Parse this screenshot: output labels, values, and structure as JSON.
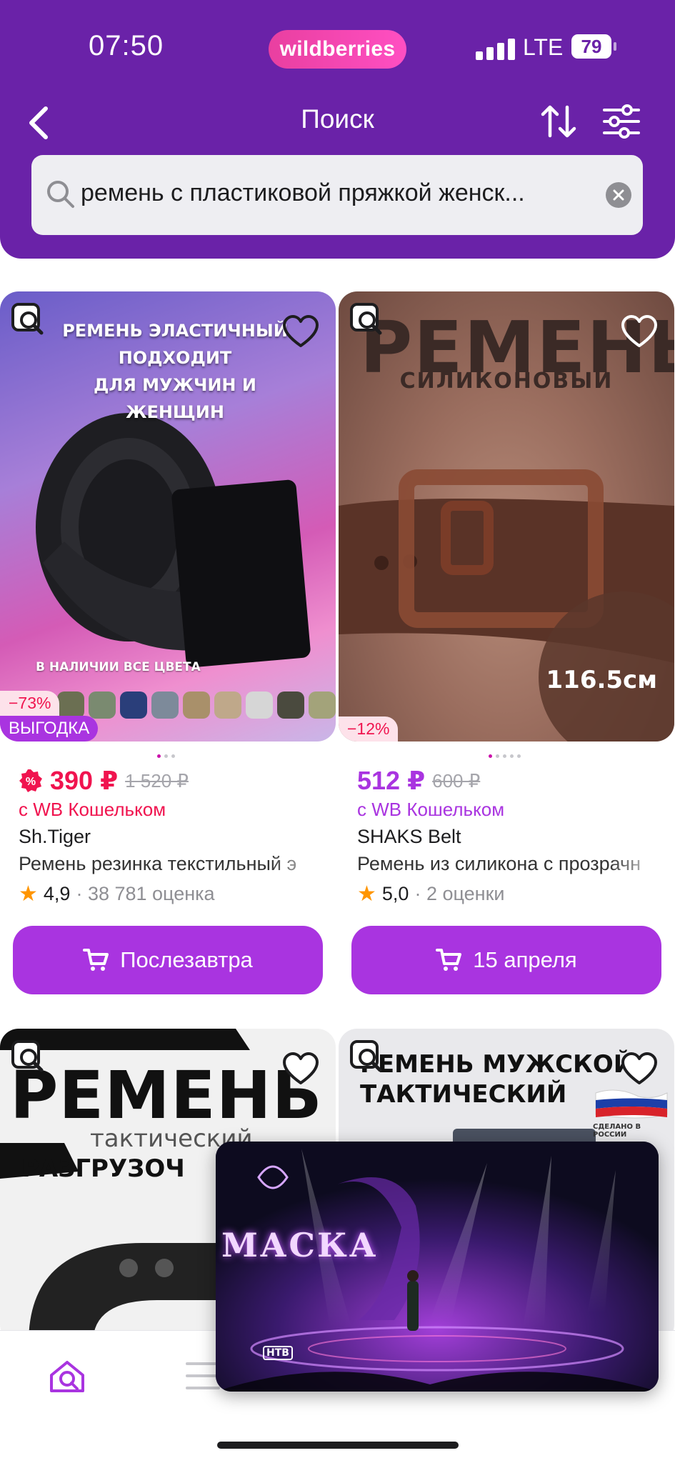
{
  "status_bar": {
    "time": "07:50",
    "brand": "wildberries",
    "network": "LTE",
    "battery": "79"
  },
  "nav": {
    "title": "Поиск"
  },
  "search": {
    "query": "ремень с пластиковой пряжкой женск..."
  },
  "products": [
    {
      "image_text_1": "РЕМЕНЬ ЭЛАСТИЧНЫЙ",
      "image_text_2": "ПОДХОДИТ",
      "image_text_3": "ДЛЯ МУЖЧИН И ЖЕНЩИН",
      "image_text_4": "В НАЛИЧИИ ВСЕ ЦВЕТА",
      "discount": "−73%",
      "tag": "ВЫГОДКА",
      "price": "390 ₽",
      "old_price": "1 520 ₽",
      "wallet": "с WB Кошельком",
      "brand": "Sh.Tiger",
      "name": "Ремень резинка текстильный э",
      "rating": "4,9",
      "reviews": "· 38 781 оценка",
      "delivery": "Послезавтра"
    },
    {
      "image_text_1": "РЕМЕНЬ",
      "image_text_2": "СИЛИКОНОВЫЙ",
      "image_text_3": "116.5см",
      "discount": "−12%",
      "price": "512 ₽",
      "old_price": "600 ₽",
      "wallet": "с WB Кошельком",
      "brand": "SHAKS Belt",
      "name": "Ремень из силикона с прозрачн",
      "rating": "5,0",
      "reviews": "· 2 оценки",
      "delivery": "15 апреля"
    },
    {
      "image_text_1": "РЕМЕНЬ",
      "image_text_2": "тактический",
      "image_text_3": "РАЗГРУЗОЧ"
    },
    {
      "image_text_1": "РЕМЕНЬ МУЖСКОЙ",
      "image_text_2": "ТАКТИЧЕСКИЙ",
      "image_text_3": "СДЕЛАНО В РОССИИ"
    }
  ],
  "pip": {
    "show_title": "МАСКА",
    "channel": "НТВ"
  },
  "colors": {
    "brand_purple": "#6a22a8",
    "accent": "#a934e0",
    "sale": "#f0144f",
    "pill": "#e93fa0"
  }
}
